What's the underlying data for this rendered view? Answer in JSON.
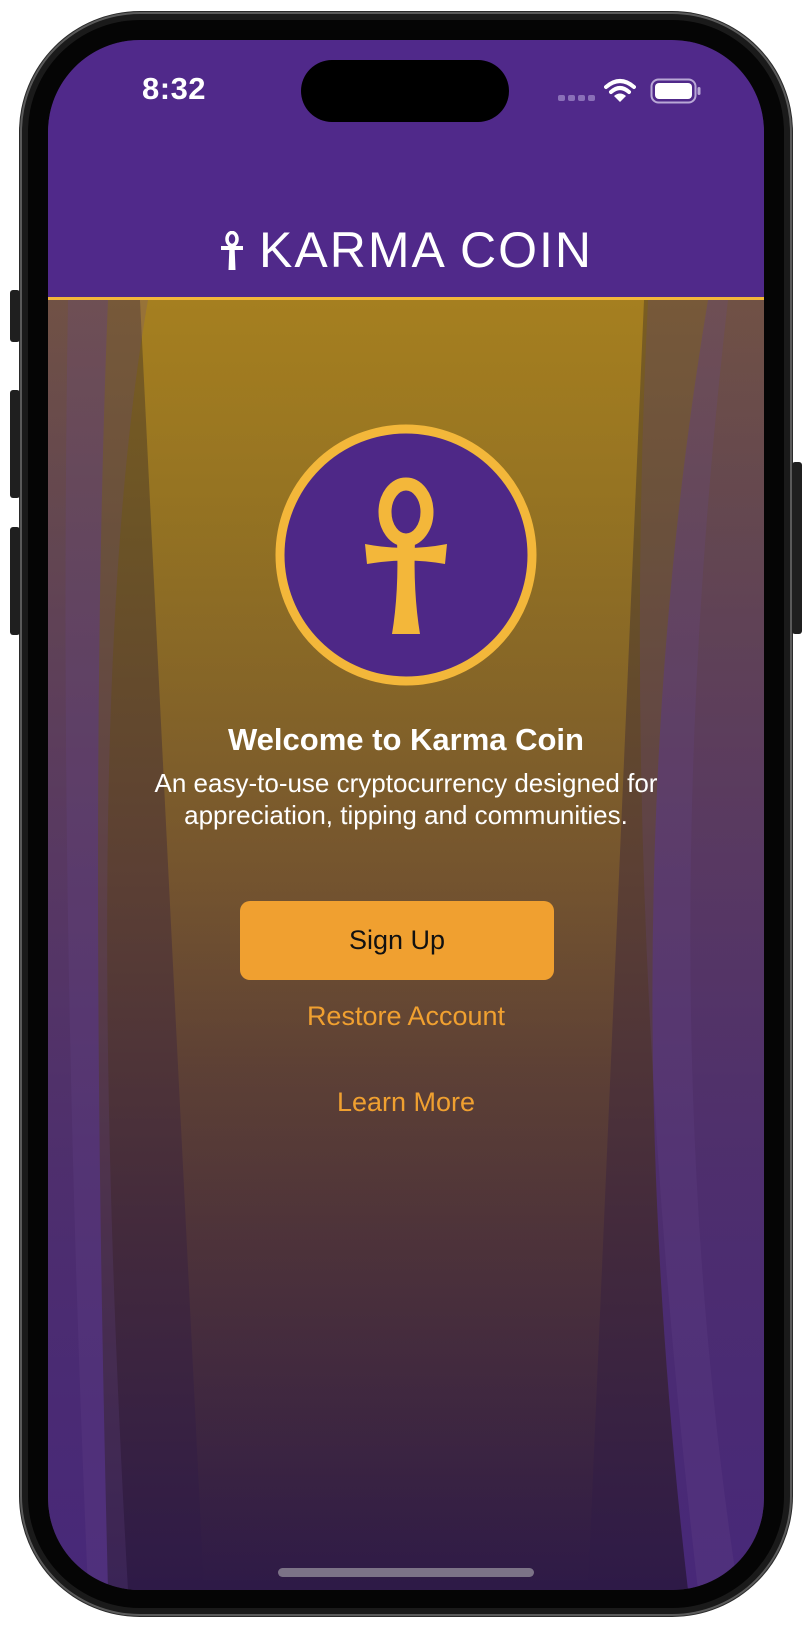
{
  "status_bar": {
    "time": "8:32",
    "icons": [
      "cellular-signal-icon",
      "wifi-icon",
      "battery-icon"
    ]
  },
  "header": {
    "icon": "ankh-icon",
    "title": "KARMA COIN"
  },
  "welcome": {
    "emblem_icon": "ankh-icon",
    "heading": "Welcome to Karma Coin",
    "tagline": "An easy-to-use cryptocurrency designed for appreciation, tipping and communities."
  },
  "actions": {
    "signup_label": "Sign Up",
    "restore_label": "Restore Account",
    "learn_more_label": "Learn More"
  },
  "colors": {
    "header_bg": "#50298a",
    "accent": "#f3b73a",
    "button": "#f0a030",
    "emblem_fill": "#4e2887"
  }
}
